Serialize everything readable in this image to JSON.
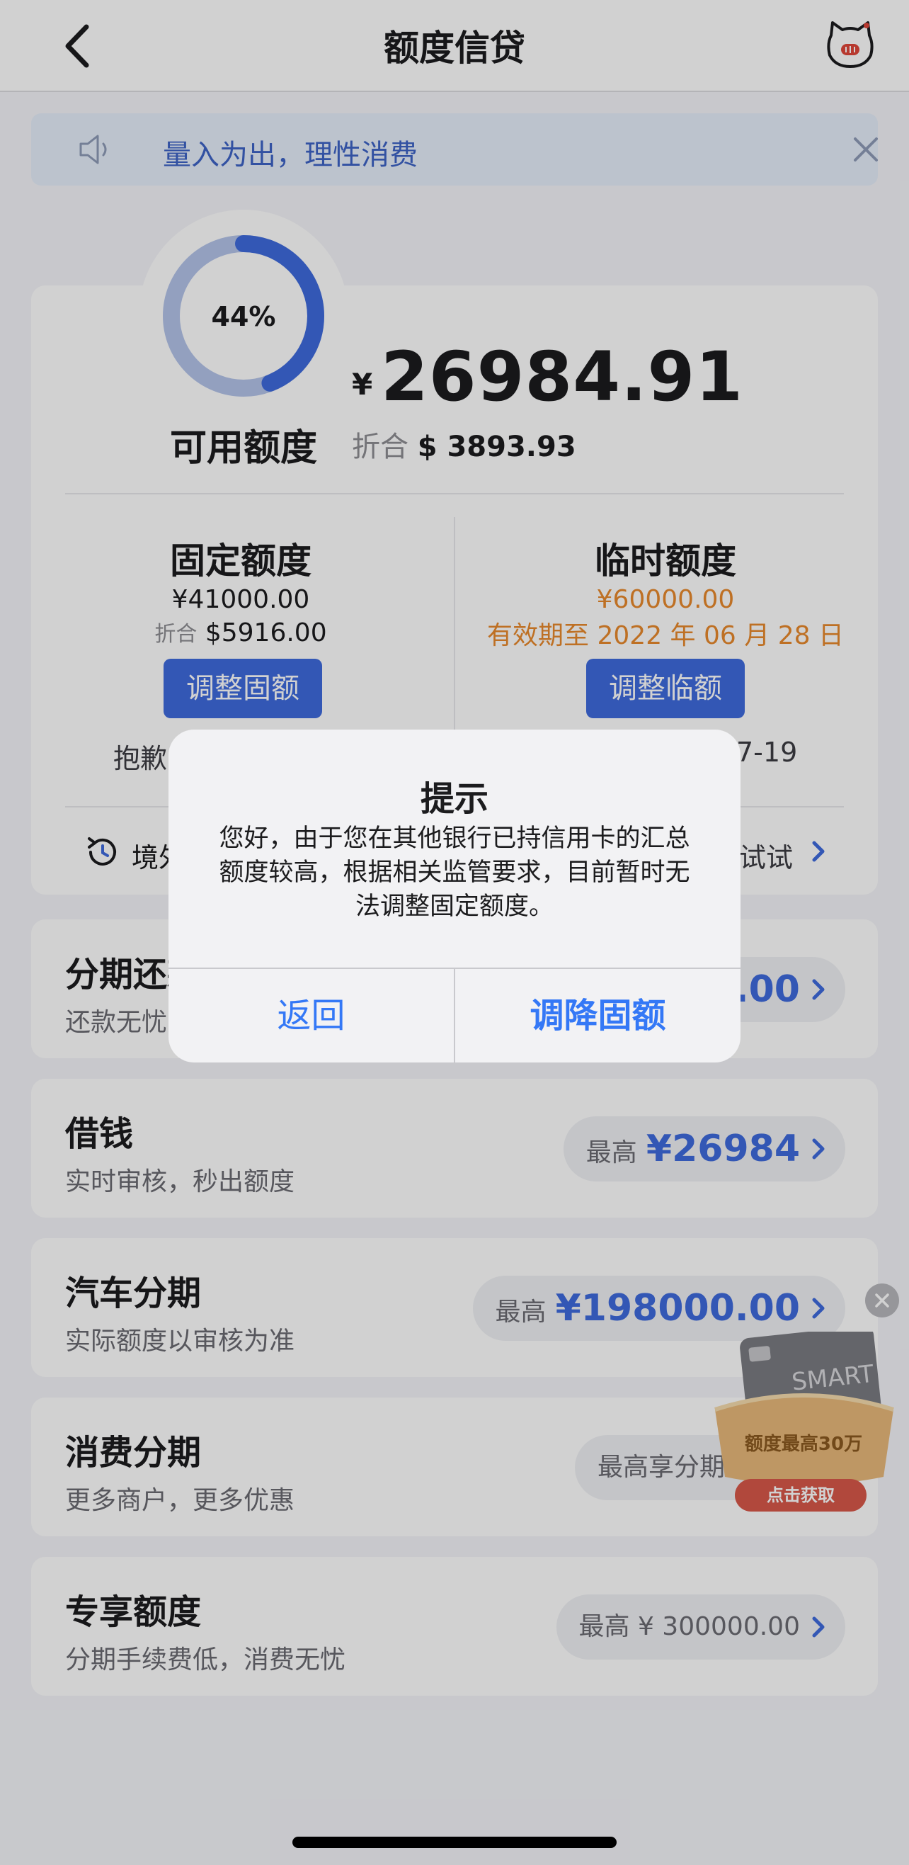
{
  "header": {
    "title": "额度信贷"
  },
  "notice": {
    "text": "量入为出，理性消费"
  },
  "credit": {
    "usage_percent": 44,
    "usage_percent_label": "44%",
    "available_label": "可用额度",
    "currency_symbol": "¥",
    "available_amount": "26984.91",
    "converted_prefix": "折合",
    "converted_value": "$ 3893.93",
    "fixed": {
      "title": "固定额度",
      "amount": "¥41000.00",
      "converted_prefix": "折合",
      "converted_value": "$5916.00",
      "button": "调整固额",
      "partial_note": "抱歉，"
    },
    "temp": {
      "title": "临时额度",
      "amount": "¥60000.00",
      "validity": "有效期至 2022 年 06 月 28 日",
      "button": "调整临额",
      "partial_note": "7-19"
    },
    "bottom_left_partial": "境外",
    "bottom_right_partial": "试试"
  },
  "products": [
    {
      "title": "分期还款",
      "subtitle": "还款无忧",
      "prefix": "",
      "value": "3.00"
    },
    {
      "title": "借钱",
      "subtitle": "实时审核，秒出额度",
      "prefix": "最高",
      "value": "¥26984"
    },
    {
      "title": "汽车分期",
      "subtitle": "实际额度以审核为准",
      "prefix": "最高",
      "value": "¥198000.00"
    },
    {
      "title": "消费分期",
      "subtitle": "更多商户，更多优惠",
      "prefix": "最高享分期",
      "value": ""
    },
    {
      "title": "专享额度",
      "subtitle": "分期手续费低，消费无忧",
      "prefix": "最高 ¥ 300000.00",
      "value": ""
    }
  ],
  "promo": {
    "card_text": "SMART",
    "label": "额度最高30万",
    "button": "点击获取"
  },
  "dialog": {
    "title": "提示",
    "message": "您好，由于您在其他银行已持信用卡的汇总额度较高，根据相关监管要求，目前暂时无法调整固定额度。",
    "cancel": "返回",
    "confirm": "调降固额"
  },
  "colors": {
    "accent": "#3f6bdd",
    "orange": "#e8892d",
    "dialog_link": "#3478f6"
  }
}
